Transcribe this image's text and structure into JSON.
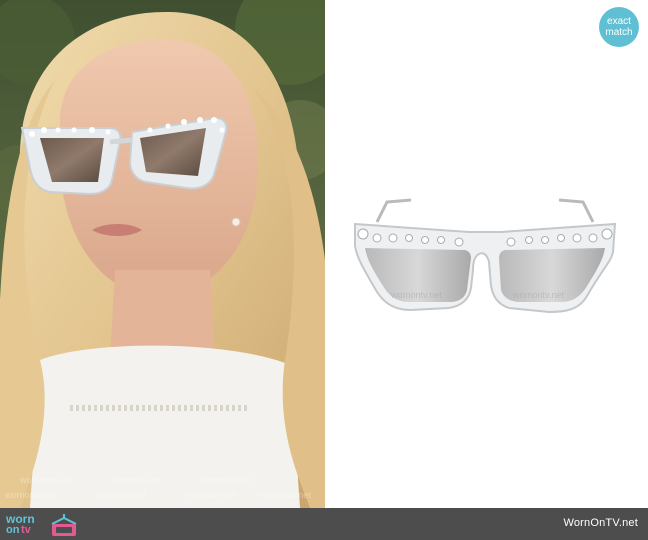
{
  "badge": {
    "line1": "exact",
    "line2": "match",
    "color": "#5fc0d3"
  },
  "photo": {
    "description_icon": "woman-wearing-sunglasses-photo",
    "watermark_text": "wornontv.net"
  },
  "product": {
    "icon": "clear-crystal-cat-eye-sunglasses",
    "watermark_text": "wornontv.net"
  },
  "footer": {
    "logo_worn": "worn",
    "logo_on": "on",
    "logo_tv": "tv",
    "site": "WornOnTV.net",
    "background": "#4d4d4d",
    "accent_blue": "#62c3d6",
    "accent_pink": "#e25a92"
  }
}
